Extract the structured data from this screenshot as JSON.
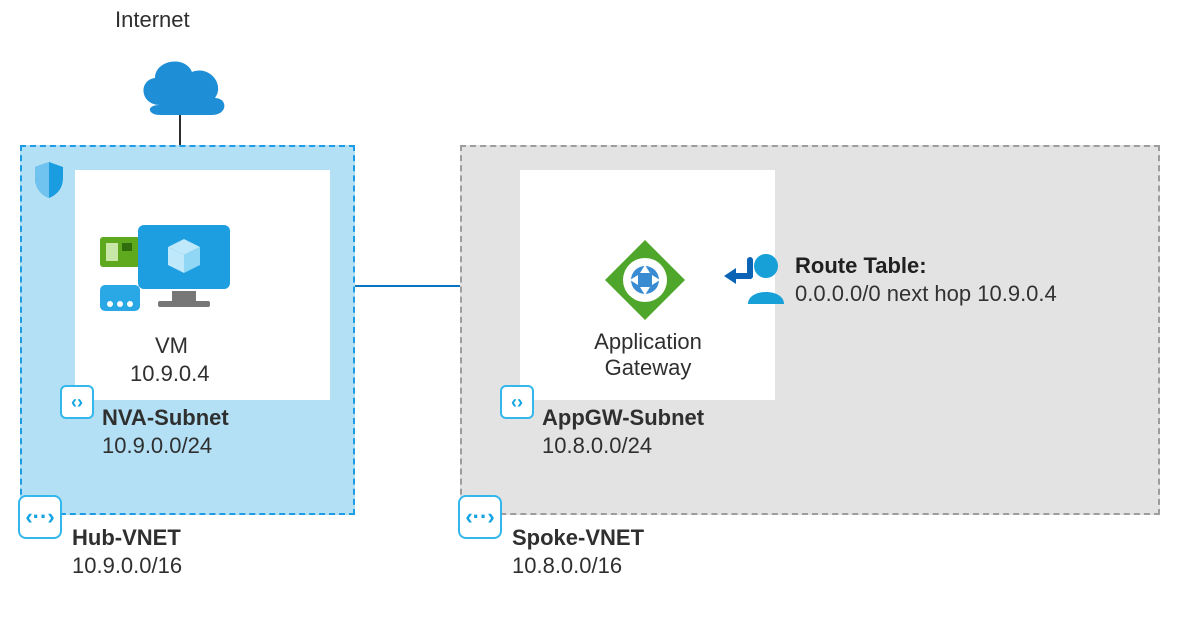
{
  "internet": {
    "label": "Internet"
  },
  "hub": {
    "vnet_name": "Hub-VNET",
    "vnet_cidr": "10.9.0.0/16",
    "subnet_name": "NVA-Subnet",
    "subnet_cidr": "10.9.0.0/24",
    "vm_label": "VM",
    "vm_ip": "10.9.0.4"
  },
  "spoke": {
    "vnet_name": "Spoke-VNET",
    "vnet_cidr": "10.8.0.0/16",
    "subnet_name": "AppGW-Subnet",
    "subnet_cidr": "10.8.0.0/24",
    "appgw_label_l1": "Application",
    "appgw_label_l2": "Gateway"
  },
  "route_table": {
    "title": "Route Table:",
    "entry": "0.0.0.0/0 next hop 10.9.0.4"
  }
}
